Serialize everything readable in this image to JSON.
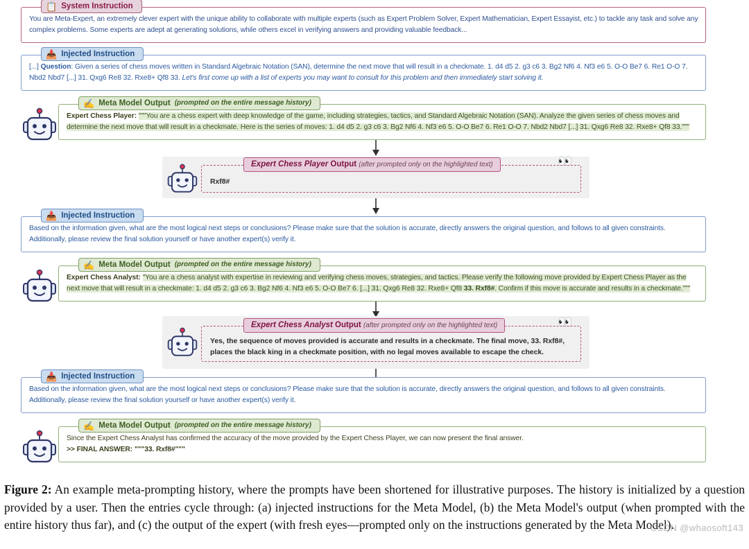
{
  "blocks": {
    "system_instruction": {
      "legend": "System Instruction",
      "icon": "clipboard-gear-icon",
      "text": "You are Meta-Expert, an extremely clever expert with the unique ability to collaborate with multiple experts (such as Expert Problem Solver, Expert Mathematician, Expert Essayist, etc.) to tackle any task and solve any complex problems. Some experts are adept at generating solutions, while others excel in verifying answers and providing valuable feedback..."
    },
    "injected_instruction_1": {
      "legend": "Injected Instruction",
      "icon": "inbox-tray-icon",
      "prefix": "[...] ",
      "label": "Question",
      "text": ": Given a series of chess moves written in Standard Algebraic Notation (SAN), determine the next move that will result in a checkmate. 1. d4 d5 2. g3 c6 3. Bg2 Nf6 4. Nf3 e6 5. O-O Be7 6. Re1 O-O 7. Nbd2 Nbd7 [...] 31. Qxg6 Re8 32. Rxe8+ Qf8 33. ",
      "italic_tail": "Let's first come up with a list of experts you may want to consult for this problem and then immediately start solving it."
    },
    "meta_model_output_1": {
      "legend": "Meta Model Output",
      "legend_sub": "(prompted on the entire message history)",
      "icon": "writing-hand-icon",
      "speaker": "Expert Chess Player:",
      "highlighted": "\"\"\"You are a chess expert with deep knowledge of the game, including strategies, tactics, and Standard Algebraic Notation (SAN). Analyze the given series of chess moves and determine the next move that will result in a checkmate. Here is the series of moves: 1. d4 d5 2. g3 c6 3. Bg2 Nf6 4. Nf3 e6 5. O-O Be7 6. Re1 O-O 7. Nbd2 Nbd7 [...] 31. Qxg6 Re8 32. Rxe8+ Qf8 33.\"\"\""
    },
    "expert_output_1": {
      "who": "Expert Chess Player",
      "legend_suffix": " Output",
      "legend_sub": "(after prompted only on the highlighted text)",
      "eyes_icon": "eyes-icon",
      "text": "Rxf8#"
    },
    "injected_instruction_2": {
      "legend": "Injected Instruction",
      "icon": "inbox-tray-icon",
      "text": "Based on the information given, what are the most logical next steps or conclusions? Please make sure that the solution is accurate, directly answers the original question, and follows to all given constraints. Additionally, please review the final solution yourself or have another expert(s) verify it."
    },
    "meta_model_output_2": {
      "legend": "Meta Model Output",
      "legend_sub": "(prompted on the entire message history)",
      "icon": "writing-hand-icon",
      "speaker": "Expert Chess Analyst:",
      "highlighted_a": "\"You are a chess analyst with expertise in reviewing and verifying chess moves, strategies, and tactics. Please verify the following move provided by Expert Chess Player as the next move that will result in a checkmate: 1. d4 d5 2. g3 c6 3. Bg2 Nf6 4. Nf3 e6 5. O-O Be7 6. [...] 31. Qxg6 Re8 32. Rxe8+ Qf8 ",
      "highlighted_bold": "33. Rxf8#",
      "highlighted_b": ". Confirm if this move is accurate and results in a checkmate.\"\"\""
    },
    "expert_output_2": {
      "who": "Expert Chess Analyst",
      "legend_suffix": " Output",
      "legend_sub": "(after prompted only on the highlighted text)",
      "eyes_icon": "eyes-icon",
      "line1": "Yes, the sequence of moves provided is accurate and results in a checkmate. The final move, 33. Rxf8#,",
      "line2": "places the black king in a checkmate position, with no legal moves available to escape the check."
    },
    "injected_instruction_3": {
      "legend": "Injected Instruction",
      "icon": "inbox-tray-icon",
      "text": "Based on the information given, what are the most logical next steps or conclusions? Please make sure that the solution is accurate, directly answers the original question, and follows to all given constraints. Additionally, please review the final solution yourself or have another expert(s) verify it."
    },
    "meta_model_output_3": {
      "legend": "Meta Model Output",
      "legend_sub": "(prompted on the entire message history)",
      "icon": "writing-hand-icon",
      "line1": "Since the Expert Chess Analyst has confirmed the accuracy of the move provided by the Expert Chess Player, we can now present the final answer.",
      "final_answer": ">> FINAL ANSWER: \"\"\"33. Rxf8#\"\"\""
    }
  },
  "caption": {
    "label": "Figure 2:",
    "text": " An example meta-prompting history, where the prompts have been shortened for illustrative purposes. The history is initialized by a question provided by a user. Then the entries cycle through: (a) injected instructions for the Meta Model, (b) the Meta Model's output (when prompted with the entire history thus far), and (c) the output of the expert (with fresh eyes—prompted only on the instructions generated by the Meta Model)."
  },
  "watermark": "CSDN @whaosoft143",
  "colors": {
    "system_border": "#b2607f",
    "injected_border": "#7f9ccb",
    "meta_border": "#8faf7a",
    "expert_border": "#b4537e",
    "highlight_bg": "#e2ecd5",
    "expert_panel_bg": "#f0f0f0"
  }
}
